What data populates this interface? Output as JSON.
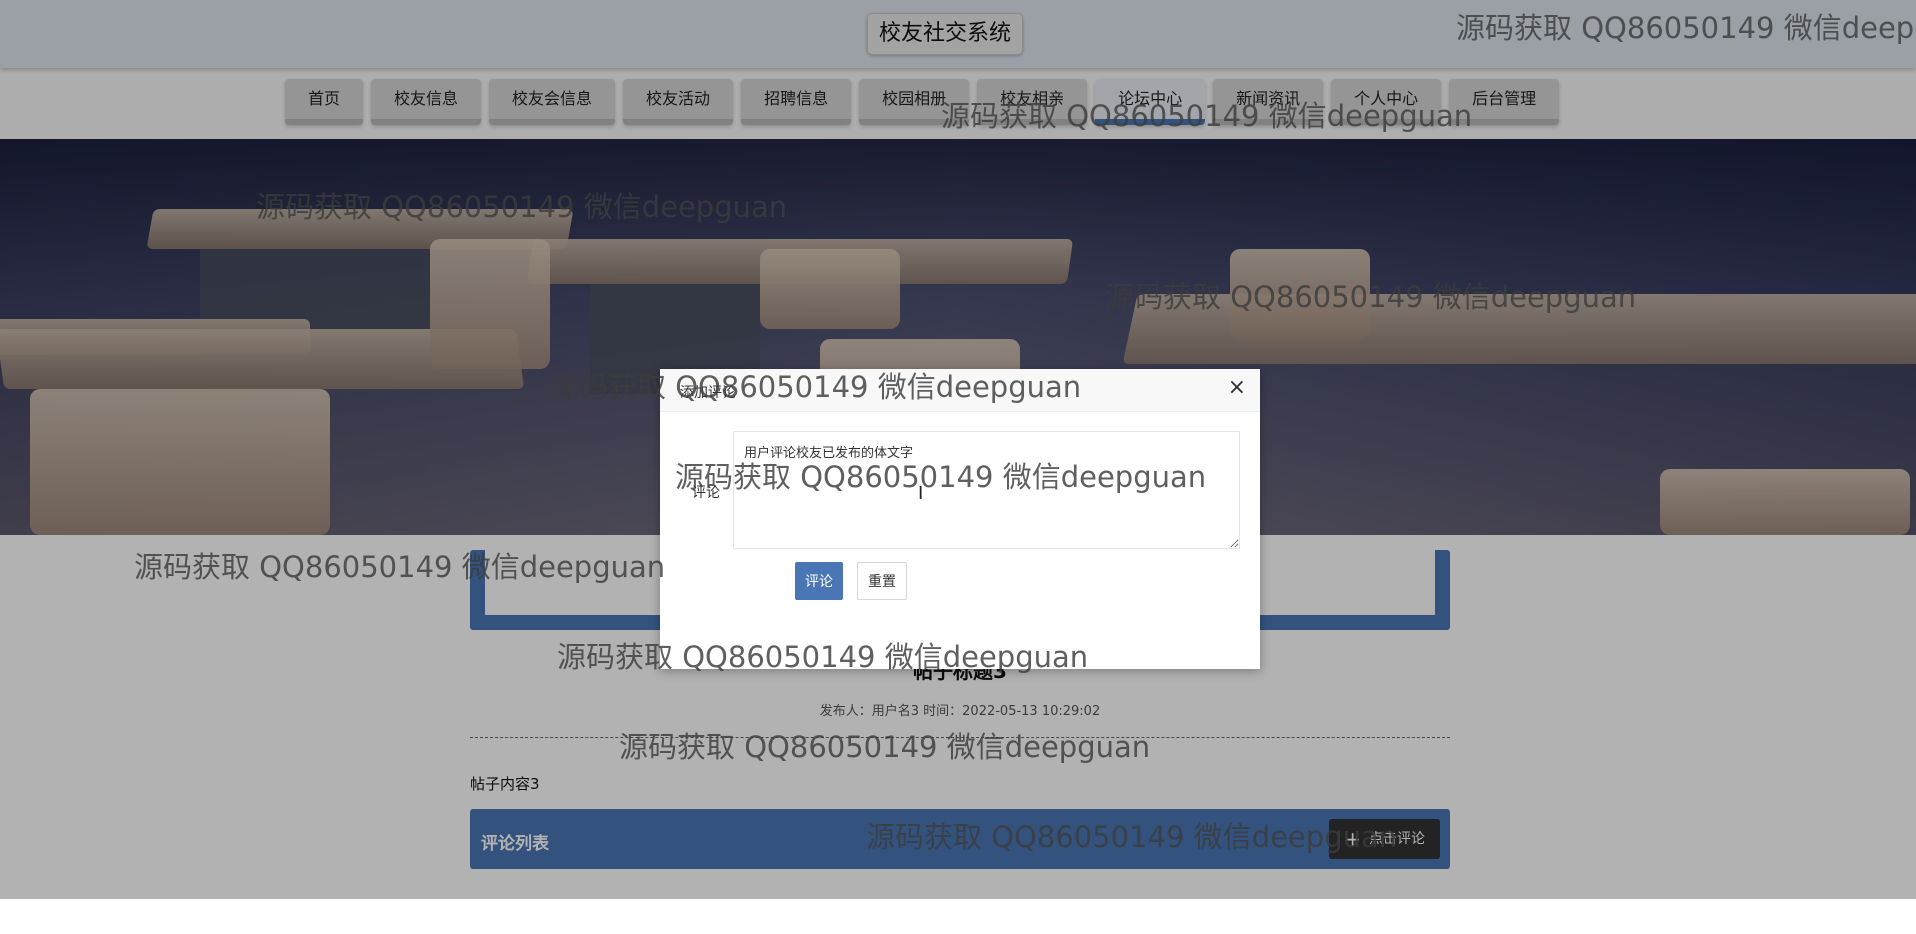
{
  "header": {
    "site_title": "校友社交系统"
  },
  "nav": {
    "items": [
      {
        "label": "首页"
      },
      {
        "label": "校友信息"
      },
      {
        "label": "校友会信息"
      },
      {
        "label": "校友活动"
      },
      {
        "label": "招聘信息"
      },
      {
        "label": "校园相册"
      },
      {
        "label": "校友相亲"
      },
      {
        "label": "论坛中心",
        "active": true
      },
      {
        "label": "新闻资讯"
      },
      {
        "label": "个人中心"
      },
      {
        "label": "后台管理"
      }
    ]
  },
  "post": {
    "title": "帖子标题3",
    "meta": "发布人：用户名3 时间：2022-05-13 10:29:02",
    "content": "帖子内容3",
    "comments_header": "评论列表",
    "add_comment_label": "点击评论"
  },
  "modal": {
    "title": "添加评论",
    "close_glyph": "×",
    "field_label": "评论",
    "textarea_value": "用户评论校友已发布的体文字",
    "submit_label": "评论",
    "reset_label": "重置"
  },
  "watermark": "源码获取 QQ86050149 微信deepguan",
  "colors": {
    "accent": "#4a76b5",
    "header_bg": "#dfe6ee",
    "dark_button": "#333333"
  },
  "icons": {
    "plus": "+",
    "text_cursor": "I"
  }
}
